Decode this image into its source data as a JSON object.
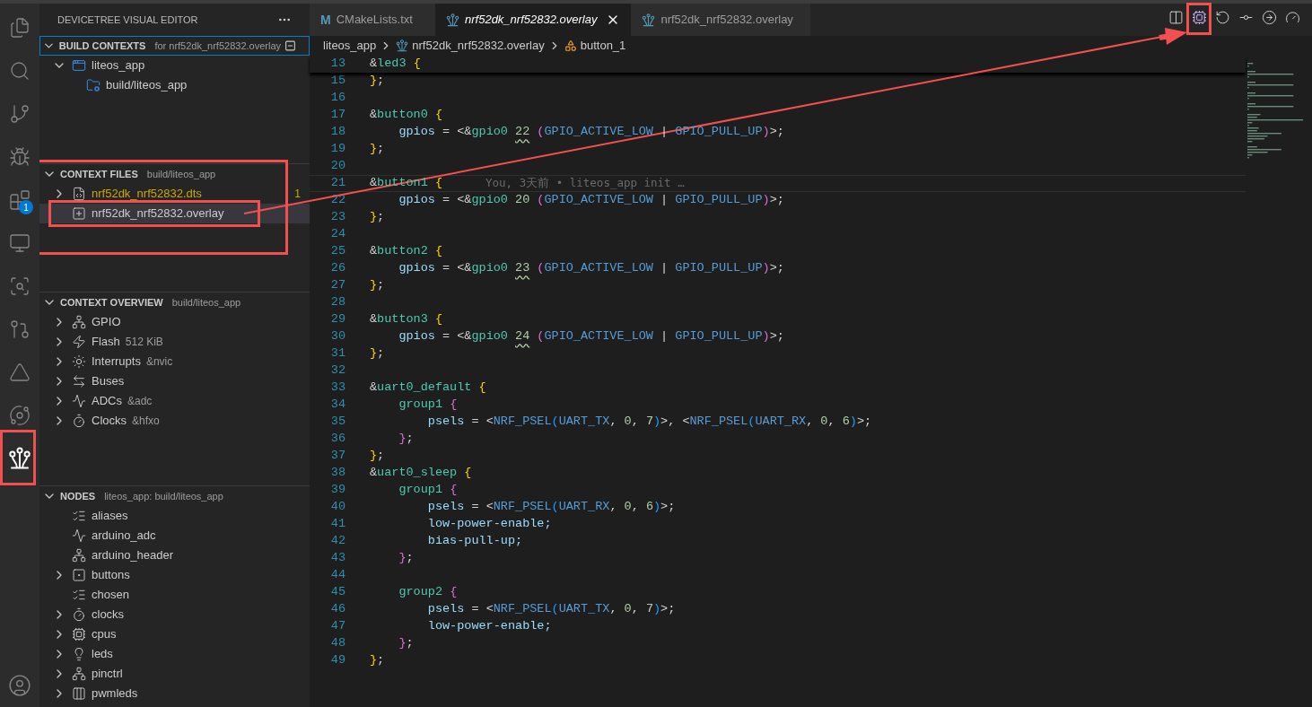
{
  "activity_bar": {
    "items": [
      {
        "kind": "files",
        "selected": false,
        "highlighted": false
      },
      {
        "kind": "search",
        "selected": false,
        "highlighted": false
      },
      {
        "kind": "source-control",
        "selected": false,
        "highlighted": false
      },
      {
        "kind": "debug",
        "selected": false,
        "highlighted": false
      },
      {
        "kind": "extensions",
        "selected": false,
        "highlighted": false,
        "badge": "1"
      },
      {
        "kind": "remote",
        "selected": false,
        "highlighted": false
      },
      {
        "kind": "scan",
        "selected": false,
        "highlighted": false
      },
      {
        "kind": "graph",
        "selected": false,
        "highlighted": false
      },
      {
        "kind": "triangle",
        "selected": false,
        "highlighted": false
      },
      {
        "kind": "orbit",
        "selected": false,
        "highlighted": false
      },
      {
        "kind": "devicetree",
        "selected": true,
        "highlighted": true
      }
    ]
  },
  "sidebar": {
    "title": "DEVICETREE VISUAL EDITOR",
    "sections": [
      {
        "title": "BUILD CONTEXTS",
        "description": "for nrf52dk_nrf52832.overlay",
        "focused": true,
        "highlighted": false,
        "items": [
          {
            "label": "liteos_app",
            "kind": "app",
            "expanded": true,
            "selected": false,
            "highlighted": false,
            "children": [
              {
                "label": "build/liteos_app",
                "kind": "build",
                "selected": false,
                "highlighted": false
              }
            ]
          }
        ]
      },
      {
        "title": "CONTEXT FILES",
        "description": "build/liteos_app",
        "focused": false,
        "highlighted": true,
        "items": [
          {
            "label": "nrf52dk_nrf52832.dts",
            "kind": "dts",
            "expanded": false,
            "selected": false,
            "highlighted": false,
            "warning": true,
            "decoration": "1"
          },
          {
            "label": "nrf52dk_nrf52832.overlay",
            "kind": "overlay",
            "selected": true,
            "highlighted": true,
            "warning": false
          }
        ]
      },
      {
        "title": "CONTEXT OVERVIEW",
        "description": "build/liteos_app",
        "focused": false,
        "highlighted": false,
        "items": [
          {
            "label": "GPIO",
            "kind": "gpio",
            "expanded": false,
            "selected": false,
            "highlighted": false
          },
          {
            "label": "Flash",
            "detail": "512 KiB",
            "kind": "flash",
            "expanded": false,
            "selected": false,
            "highlighted": false
          },
          {
            "label": "Interrupts",
            "detail": "&nvic",
            "kind": "interrupts",
            "expanded": false,
            "selected": false,
            "highlighted": false
          },
          {
            "label": "Buses",
            "kind": "buses",
            "expanded": false,
            "selected": false,
            "highlighted": false
          },
          {
            "label": "ADCs",
            "detail": "&adc",
            "kind": "adc",
            "expanded": false,
            "selected": false,
            "highlighted": false
          },
          {
            "label": "Clocks",
            "detail": "&hfxo",
            "kind": "clock",
            "expanded": false,
            "selected": false,
            "highlighted": false
          }
        ]
      },
      {
        "title": "NODES",
        "description": "liteos_app: build/liteos_app",
        "focused": false,
        "highlighted": false,
        "items": [
          {
            "label": "aliases",
            "kind": "list",
            "selected": false,
            "highlighted": false
          },
          {
            "label": "arduino_adc",
            "kind": "adc",
            "selected": false,
            "highlighted": false
          },
          {
            "label": "arduino_header",
            "kind": "gpio",
            "selected": false,
            "highlighted": false
          },
          {
            "label": "buttons",
            "kind": "button",
            "expanded": false,
            "selected": false,
            "highlighted": false
          },
          {
            "label": "chosen",
            "kind": "list",
            "selected": false,
            "highlighted": false
          },
          {
            "label": "clocks",
            "kind": "clock",
            "expanded": false,
            "selected": false,
            "highlighted": false
          },
          {
            "label": "cpus",
            "kind": "cpu",
            "expanded": false,
            "selected": false,
            "highlighted": false
          },
          {
            "label": "leds",
            "kind": "led",
            "expanded": false,
            "selected": false,
            "highlighted": false
          },
          {
            "label": "pinctrl",
            "kind": "gpio",
            "expanded": false,
            "selected": false,
            "highlighted": false
          },
          {
            "label": "pwmleds",
            "kind": "pwm",
            "expanded": false,
            "selected": false,
            "highlighted": false
          }
        ]
      }
    ]
  },
  "tabs": [
    {
      "label": "CMakeLists.txt",
      "kind": "cmake",
      "icon_text": "M",
      "selected": false,
      "preview": false
    },
    {
      "label": "nrf52dk_nrf52832.overlay",
      "kind": "devicetree",
      "selected": true,
      "preview": true
    },
    {
      "label": "nrf52dk_nrf52832.overlay",
      "kind": "devicetree",
      "selected": false,
      "preview": false
    }
  ],
  "editor_actions": [
    {
      "kind": "split",
      "highlighted": false
    },
    {
      "kind": "cpu",
      "highlighted": true
    },
    {
      "kind": "undo",
      "highlighted": false
    },
    {
      "kind": "commit",
      "highlighted": false
    },
    {
      "kind": "next",
      "highlighted": false
    },
    {
      "kind": "gauge",
      "highlighted": false
    }
  ],
  "breadcrumbs": [
    {
      "label": "liteos_app",
      "kind": "folder"
    },
    {
      "label": "nrf52dk_nrf52832.overlay",
      "kind": "devicetree"
    },
    {
      "label": "button_1",
      "kind": "symbol"
    }
  ],
  "code_lines": [
    {
      "n": "13",
      "sticky": true,
      "current": false,
      "tokens": [
        {
          "text": "&",
          "kind": "op"
        },
        {
          "text": "led3 ",
          "kind": "label"
        },
        {
          "text": "{",
          "kind": "b1"
        }
      ]
    },
    {
      "n": "15",
      "sticky": false,
      "current": false,
      "tokens": [
        {
          "text": "}",
          "kind": "b1"
        },
        {
          "text": ";",
          "kind": "op"
        }
      ]
    },
    {
      "n": "16",
      "sticky": false,
      "current": false
    },
    {
      "n": "17",
      "sticky": false,
      "current": false,
      "tokens": [
        {
          "text": "&",
          "kind": "op"
        },
        {
          "text": "button0 ",
          "kind": "label"
        },
        {
          "text": "{",
          "kind": "b1"
        }
      ]
    },
    {
      "n": "18",
      "sticky": false,
      "current": false,
      "tokens": [
        {
          "text": "    gpios",
          "kind": "prop"
        },
        {
          "text": " = <&",
          "kind": "op"
        },
        {
          "text": "gpio0 ",
          "kind": "label"
        },
        {
          "text": "22",
          "kind": "numw"
        },
        {
          "text": " (",
          "kind": "b2"
        },
        {
          "text": "GPIO_ACTIVE_LOW",
          "kind": "macro"
        },
        {
          "text": " | ",
          "kind": "op"
        },
        {
          "text": "GPIO_PULL_UP",
          "kind": "macro"
        },
        {
          "text": ")",
          "kind": "b2"
        },
        {
          "text": ">;",
          "kind": "op"
        }
      ]
    },
    {
      "n": "19",
      "sticky": false,
      "current": false,
      "tokens": [
        {
          "text": "}",
          "kind": "b1"
        },
        {
          "text": ";",
          "kind": "op"
        }
      ]
    },
    {
      "n": "20",
      "sticky": false,
      "current": false
    },
    {
      "n": "21",
      "sticky": false,
      "current": true,
      "blame": "You, 3天前 • liteos_app init …",
      "tokens": [
        {
          "text": "&",
          "kind": "op"
        },
        {
          "text": "button1 ",
          "kind": "label"
        },
        {
          "text": "{",
          "kind": "b1"
        }
      ]
    },
    {
      "n": "22",
      "sticky": false,
      "current": false,
      "tokens": [
        {
          "text": "    gpios",
          "kind": "prop"
        },
        {
          "text": " = <&",
          "kind": "op"
        },
        {
          "text": "gpio0 ",
          "kind": "label"
        },
        {
          "text": "20",
          "kind": "num"
        },
        {
          "text": " (",
          "kind": "b2"
        },
        {
          "text": "GPIO_ACTIVE_LOW",
          "kind": "macro"
        },
        {
          "text": " | ",
          "kind": "op"
        },
        {
          "text": "GPIO_PULL_UP",
          "kind": "macro"
        },
        {
          "text": ")",
          "kind": "b2"
        },
        {
          "text": ">;",
          "kind": "op"
        }
      ]
    },
    {
      "n": "23",
      "sticky": false,
      "current": false,
      "tokens": [
        {
          "text": "}",
          "kind": "b1"
        },
        {
          "text": ";",
          "kind": "op"
        }
      ]
    },
    {
      "n": "24",
      "sticky": false,
      "current": false
    },
    {
      "n": "25",
      "sticky": false,
      "current": false,
      "tokens": [
        {
          "text": "&",
          "kind": "op"
        },
        {
          "text": "button2 ",
          "kind": "label"
        },
        {
          "text": "{",
          "kind": "b1"
        }
      ]
    },
    {
      "n": "26",
      "sticky": false,
      "current": false,
      "tokens": [
        {
          "text": "    gpios",
          "kind": "prop"
        },
        {
          "text": " = <&",
          "kind": "op"
        },
        {
          "text": "gpio0 ",
          "kind": "label"
        },
        {
          "text": "23",
          "kind": "numw"
        },
        {
          "text": " (",
          "kind": "b2"
        },
        {
          "text": "GPIO_ACTIVE_LOW",
          "kind": "macro"
        },
        {
          "text": " | ",
          "kind": "op"
        },
        {
          "text": "GPIO_PULL_UP",
          "kind": "macro"
        },
        {
          "text": ")",
          "kind": "b2"
        },
        {
          "text": ">;",
          "kind": "op"
        }
      ]
    },
    {
      "n": "27",
      "sticky": false,
      "current": false,
      "tokens": [
        {
          "text": "}",
          "kind": "b1"
        },
        {
          "text": ";",
          "kind": "op"
        }
      ]
    },
    {
      "n": "28",
      "sticky": false,
      "current": false
    },
    {
      "n": "29",
      "sticky": false,
      "current": false,
      "tokens": [
        {
          "text": "&",
          "kind": "op"
        },
        {
          "text": "button3 ",
          "kind": "label"
        },
        {
          "text": "{",
          "kind": "b1"
        }
      ]
    },
    {
      "n": "30",
      "sticky": false,
      "current": false,
      "tokens": [
        {
          "text": "    gpios",
          "kind": "prop"
        },
        {
          "text": " = <&",
          "kind": "op"
        },
        {
          "text": "gpio0 ",
          "kind": "label"
        },
        {
          "text": "24",
          "kind": "numw"
        },
        {
          "text": " (",
          "kind": "b2"
        },
        {
          "text": "GPIO_ACTIVE_LOW",
          "kind": "macro"
        },
        {
          "text": " | ",
          "kind": "op"
        },
        {
          "text": "GPIO_PULL_UP",
          "kind": "macro"
        },
        {
          "text": ")",
          "kind": "b2"
        },
        {
          "text": ">;",
          "kind": "op"
        }
      ]
    },
    {
      "n": "31",
      "sticky": false,
      "current": false,
      "tokens": [
        {
          "text": "}",
          "kind": "b1"
        },
        {
          "text": ";",
          "kind": "op"
        }
      ]
    },
    {
      "n": "32",
      "sticky": false,
      "current": false
    },
    {
      "n": "33",
      "sticky": false,
      "current": false,
      "tokens": [
        {
          "text": "&",
          "kind": "op"
        },
        {
          "text": "uart0_default ",
          "kind": "label"
        },
        {
          "text": "{",
          "kind": "b1"
        }
      ]
    },
    {
      "n": "34",
      "sticky": false,
      "current": false,
      "tokens": [
        {
          "text": "    group1 ",
          "kind": "label"
        },
        {
          "text": "{",
          "kind": "b2"
        }
      ]
    },
    {
      "n": "35",
      "sticky": false,
      "current": false,
      "tokens": [
        {
          "text": "        psels",
          "kind": "prop"
        },
        {
          "text": " = <",
          "kind": "op"
        },
        {
          "text": "NRF_PSEL",
          "kind": "macro"
        },
        {
          "text": "(",
          "kind": "b3"
        },
        {
          "text": "UART_TX",
          "kind": "macro"
        },
        {
          "text": ", ",
          "kind": "op"
        },
        {
          "text": "0",
          "kind": "num"
        },
        {
          "text": ", ",
          "kind": "op"
        },
        {
          "text": "7",
          "kind": "num"
        },
        {
          "text": ")",
          "kind": "b3"
        },
        {
          "text": ">, <",
          "kind": "op"
        },
        {
          "text": "NRF_PSEL",
          "kind": "macro"
        },
        {
          "text": "(",
          "kind": "b3"
        },
        {
          "text": "UART_RX",
          "kind": "macro"
        },
        {
          "text": ", ",
          "kind": "op"
        },
        {
          "text": "0",
          "kind": "num"
        },
        {
          "text": ", ",
          "kind": "op"
        },
        {
          "text": "6",
          "kind": "num"
        },
        {
          "text": ")",
          "kind": "b3"
        },
        {
          "text": ">;",
          "kind": "op"
        }
      ]
    },
    {
      "n": "36",
      "sticky": false,
      "current": false,
      "tokens": [
        {
          "text": "    }",
          "kind": "b2"
        },
        {
          "text": ";",
          "kind": "op"
        }
      ]
    },
    {
      "n": "37",
      "sticky": false,
      "current": false,
      "tokens": [
        {
          "text": "}",
          "kind": "b1"
        },
        {
          "text": ";",
          "kind": "op"
        }
      ]
    },
    {
      "n": "38",
      "sticky": false,
      "current": false,
      "tokens": [
        {
          "text": "&",
          "kind": "op"
        },
        {
          "text": "uart0_sleep ",
          "kind": "label"
        },
        {
          "text": "{",
          "kind": "b1"
        }
      ]
    },
    {
      "n": "39",
      "sticky": false,
      "current": false,
      "tokens": [
        {
          "text": "    group1 ",
          "kind": "label"
        },
        {
          "text": "{",
          "kind": "b2"
        }
      ]
    },
    {
      "n": "40",
      "sticky": false,
      "current": false,
      "tokens": [
        {
          "text": "        psels",
          "kind": "prop"
        },
        {
          "text": " = <",
          "kind": "op"
        },
        {
          "text": "NRF_PSEL",
          "kind": "macro"
        },
        {
          "text": "(",
          "kind": "b3"
        },
        {
          "text": "UART_RX",
          "kind": "macro"
        },
        {
          "text": ", ",
          "kind": "op"
        },
        {
          "text": "0",
          "kind": "num"
        },
        {
          "text": ", ",
          "kind": "op"
        },
        {
          "text": "6",
          "kind": "num"
        },
        {
          "text": ")",
          "kind": "b3"
        },
        {
          "text": ">;",
          "kind": "op"
        }
      ]
    },
    {
      "n": "41",
      "sticky": false,
      "current": false,
      "tokens": [
        {
          "text": "        low-power-enable;",
          "kind": "prop"
        }
      ]
    },
    {
      "n": "42",
      "sticky": false,
      "current": false,
      "tokens": [
        {
          "text": "        bias-pull-up;",
          "kind": "prop"
        }
      ]
    },
    {
      "n": "43",
      "sticky": false,
      "current": false,
      "tokens": [
        {
          "text": "    }",
          "kind": "b2"
        },
        {
          "text": ";",
          "kind": "op"
        }
      ]
    },
    {
      "n": "44",
      "sticky": false,
      "current": false
    },
    {
      "n": "45",
      "sticky": false,
      "current": false,
      "tokens": [
        {
          "text": "    group2 ",
          "kind": "label"
        },
        {
          "text": "{",
          "kind": "b2"
        }
      ]
    },
    {
      "n": "46",
      "sticky": false,
      "current": false,
      "tokens": [
        {
          "text": "        psels",
          "kind": "prop"
        },
        {
          "text": " = <",
          "kind": "op"
        },
        {
          "text": "NRF_PSEL",
          "kind": "macro"
        },
        {
          "text": "(",
          "kind": "b3"
        },
        {
          "text": "UART_TX",
          "kind": "macro"
        },
        {
          "text": ", ",
          "kind": "op"
        },
        {
          "text": "0",
          "kind": "num"
        },
        {
          "text": ", ",
          "kind": "op"
        },
        {
          "text": "7",
          "kind": "num"
        },
        {
          "text": ")",
          "kind": "b3"
        },
        {
          "text": ">;",
          "kind": "op"
        }
      ]
    },
    {
      "n": "47",
      "sticky": false,
      "current": false,
      "tokens": [
        {
          "text": "        low-power-enable;",
          "kind": "prop"
        }
      ]
    },
    {
      "n": "48",
      "sticky": false,
      "current": false,
      "tokens": [
        {
          "text": "    }",
          "kind": "b2"
        },
        {
          "text": ";",
          "kind": "op"
        }
      ]
    },
    {
      "n": "49",
      "sticky": false,
      "current": false,
      "tokens": [
        {
          "text": "}",
          "kind": "b1"
        },
        {
          "text": ";",
          "kind": "op"
        }
      ]
    }
  ]
}
